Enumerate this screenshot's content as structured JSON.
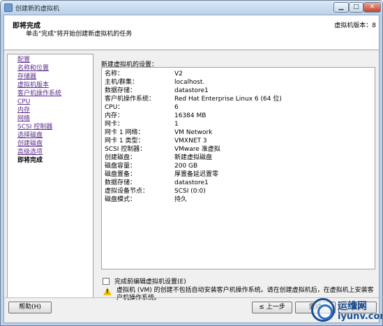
{
  "window": {
    "title": "创建新的虚拟机",
    "controls": {
      "minimize": "▁",
      "maximize": "□",
      "close": "✕"
    }
  },
  "header": {
    "title": "即将完成",
    "subtitle": "单击\"完成\"将开始创建新虚拟机的任务",
    "version": "虚拟机版本：8"
  },
  "nav": {
    "items": [
      {
        "label": "配置"
      },
      {
        "label": "名称和位置"
      },
      {
        "label": "存储器"
      },
      {
        "label": "虚拟机版本"
      },
      {
        "label": "客户机操作系统"
      },
      {
        "label": "CPU"
      },
      {
        "label": "内存"
      },
      {
        "label": "网络"
      },
      {
        "label": "SCSI 控制器"
      },
      {
        "label": "选择磁盘"
      },
      {
        "label": "创建磁盘"
      },
      {
        "label": "高级选项"
      },
      {
        "label": "即将完成"
      }
    ],
    "current": "即将完成"
  },
  "main": {
    "settings_label": "新建虚拟机的设置：",
    "settings": [
      {
        "key": "名称：",
        "value": "V2"
      },
      {
        "key": "主机/群集：",
        "value": "localhost."
      },
      {
        "key": "数据存储：",
        "value": "datastore1"
      },
      {
        "key": "客户机操作系统：",
        "value": "Red Hat Enterprise Linux 6 (64 位)"
      },
      {
        "key": "CPU：",
        "value": "6"
      },
      {
        "key": "内存：",
        "value": "16384 MB"
      },
      {
        "key": "网卡：",
        "value": "1"
      },
      {
        "key": "网卡 1 网络：",
        "value": "VM Network"
      },
      {
        "key": "网卡 1 类型：",
        "value": "VMXNET 3"
      },
      {
        "key": "SCSI 控制器：",
        "value": "VMware 准虚拟"
      },
      {
        "key": "创建磁盘：",
        "value": "新建虚拟磁盘"
      },
      {
        "key": "磁盘容量：",
        "value": "200 GB"
      },
      {
        "key": "磁盘置备：",
        "value": "厚置备延迟置零"
      },
      {
        "key": "数据存储：",
        "value": "datastore1"
      },
      {
        "key": "虚拟设备节点：",
        "value": "SCSI (0:0)"
      },
      {
        "key": "磁盘模式：",
        "value": "持久"
      }
    ],
    "edit_before_finish": "完成前编辑虚拟机设置(E)",
    "warning": "虚拟机 (VM) 的创建不包括自动安装客户机操作系统。请在创建虚拟机后，在虚拟机上安装客户机操作系统。"
  },
  "buttons": {
    "help": "帮助(H)",
    "back": "≤ 上一步",
    "finish": "完成",
    "cancel": "取消"
  },
  "watermark": {
    "cn": "运维网",
    "en": "iyunv.com"
  }
}
